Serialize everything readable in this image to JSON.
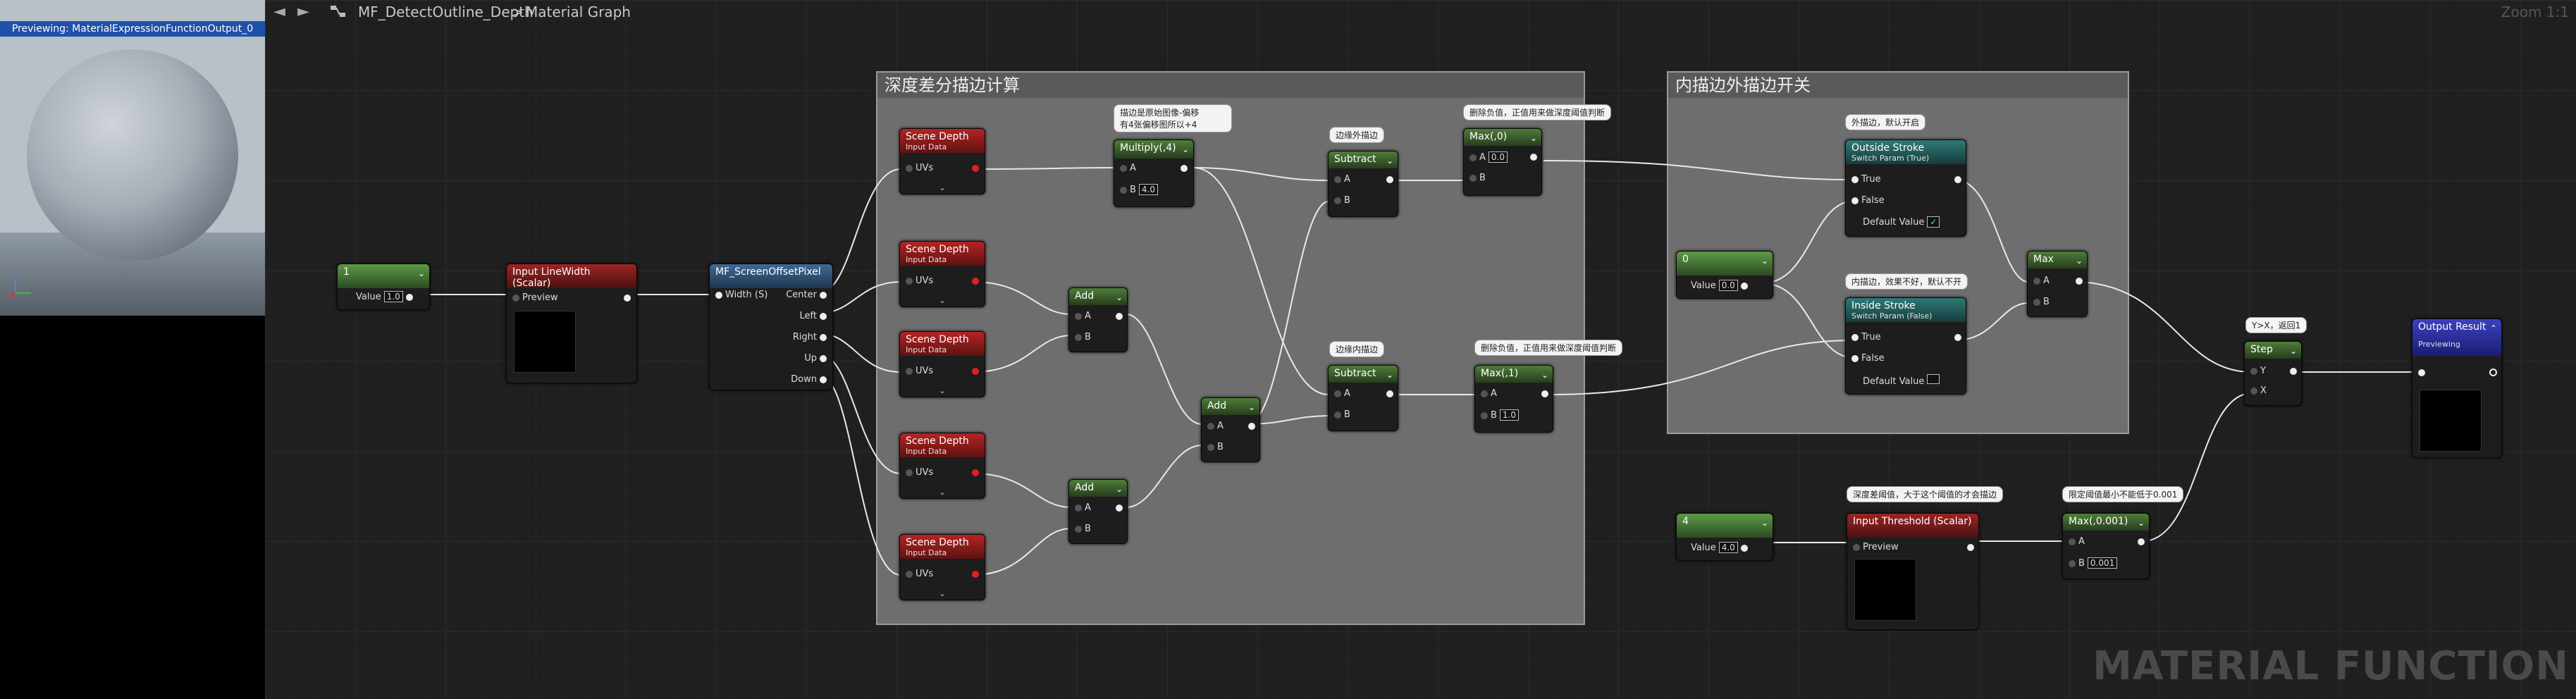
{
  "preview": {
    "label": "Previewing: MaterialExpressionFunctionOutput_0"
  },
  "header": {
    "back_icon": "arrow-left-icon",
    "forward_icon": "arrow-right-icon",
    "graph_icon": "material-graph-icon",
    "asset_name": "MF_DetectOutline_Depth",
    "separator": ">",
    "location": "Material Graph",
    "zoom": "Zoom 1:1"
  },
  "watermark": "MATERIAL FUNCTION",
  "comments": {
    "depth": "深度差分描边计算",
    "inner_outer": "内描边外描边开关"
  },
  "tips": {
    "multiply": "描边是原始图像-偏移\n有4张偏移图所以+4",
    "outer_edge": "边缘外描边",
    "inner_edge": "边缘内描边",
    "remove_neg_1": "删除负值，正值用来做深度阈值判断",
    "remove_neg_2": "删除负值，正值用来做深度阈值判断",
    "outer_default": "外描边，默认开启",
    "inner_default": "内描边，效果不好，默认不开",
    "threshold": "深度差阈值，大于这个阈值的才会描边",
    "limit": "限定阈值最小不能低于0.001",
    "step": "Y>X，返回1"
  },
  "nodes": {
    "const_one": {
      "header": "1",
      "value_label": "Value",
      "value": "1.0"
    },
    "input_linewidth": {
      "title": "Input LineWidth (Scalar)",
      "pin": "Preview"
    },
    "offset_pixel": {
      "title": "MF_ScreenOffsetPixel",
      "in": "Width (S)",
      "outs": [
        "Center",
        "Left",
        "Right",
        "Up",
        "Down"
      ]
    },
    "scene_depth": {
      "title": "Scene Depth",
      "sub": "Input Data",
      "pin": "UVs"
    },
    "multiply": {
      "title": "Multiply(,4)",
      "a": "A",
      "b": "B",
      "b_val": "4.0"
    },
    "add": {
      "title": "Add",
      "a": "A",
      "b": "B"
    },
    "subtract": {
      "title": "Subtract",
      "a": "A",
      "b": "B"
    },
    "max0": {
      "title": "Max(,0)",
      "a": "A",
      "a_val": "0.0",
      "b": "B"
    },
    "max1": {
      "title": "Max(,1)",
      "a": "A",
      "b": "B",
      "b_val": "1.0"
    },
    "outside_stroke": {
      "title": "Outside Stroke",
      "sub": "Switch Param (True)",
      "true": "True",
      "false": "False",
      "default": "Default Value"
    },
    "inside_stroke": {
      "title": "Inside Stroke",
      "sub": "Switch Param (False)",
      "true": "True",
      "false": "False",
      "default": "Default Value"
    },
    "const_zero": {
      "header": "0",
      "value_label": "Value",
      "value": "0.0"
    },
    "max": {
      "title": "Max",
      "a": "A",
      "b": "B"
    },
    "step": {
      "title": "Step",
      "y": "Y",
      "x": "X"
    },
    "output": {
      "title": "Output Result",
      "sub": "Previewing"
    },
    "const_four": {
      "header": "4",
      "value_label": "Value",
      "value": "4.0"
    },
    "input_threshold": {
      "title": "Input Threshold (Scalar)",
      "pin": "Preview"
    },
    "max_min": {
      "title": "Max(,0.001)",
      "a": "A",
      "b": "B",
      "b_val": "0.001"
    }
  }
}
